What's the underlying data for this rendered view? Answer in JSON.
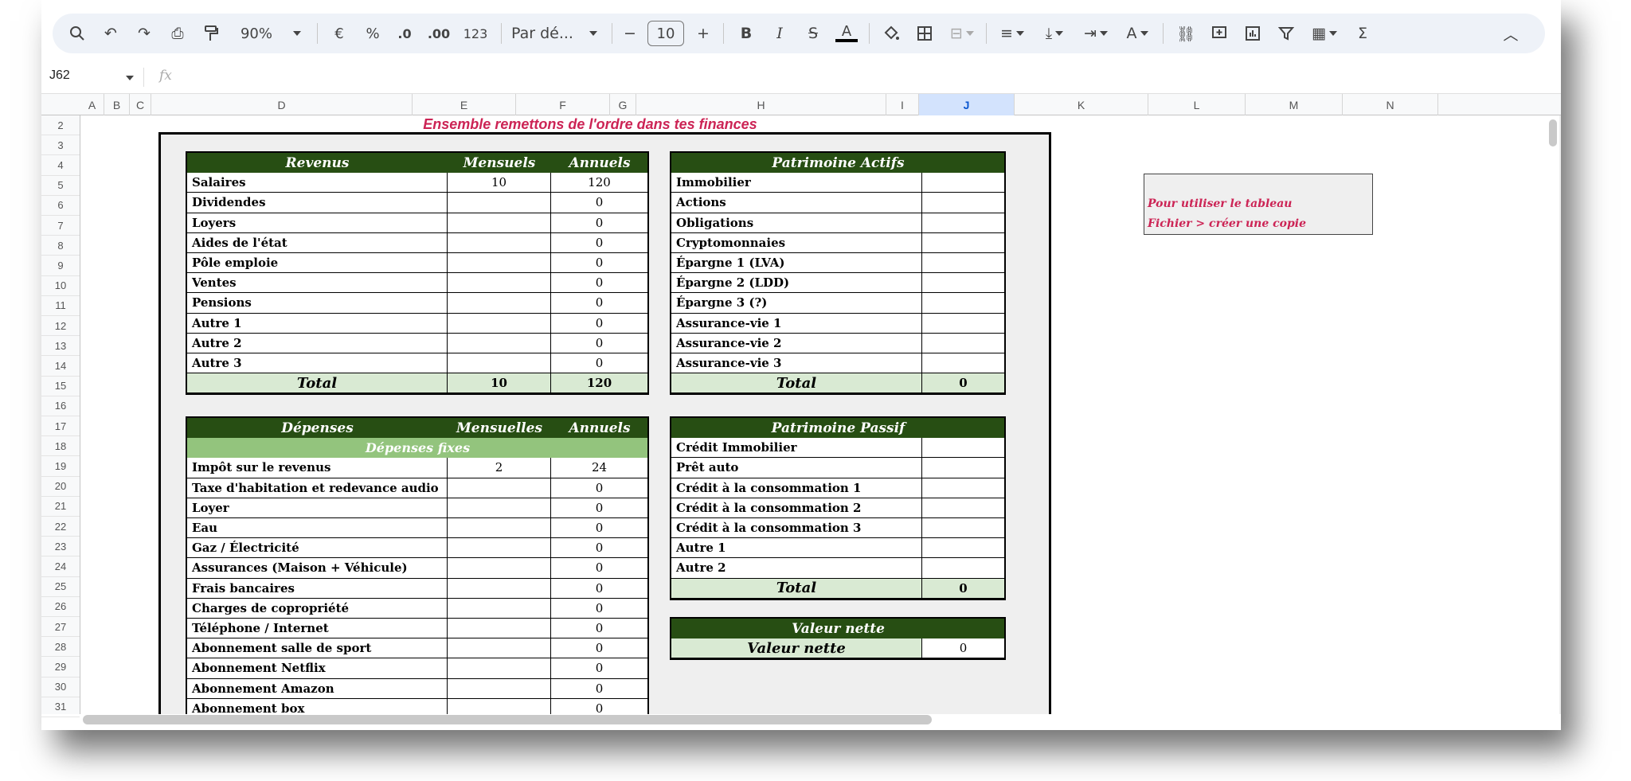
{
  "toolbar": {
    "zoom": "90%",
    "format_currency": "€",
    "format_percent": "%",
    "decimal_less": ".0",
    "decimal_more": ".00",
    "format_number": "123",
    "font": "Par dé...",
    "font_size": "10"
  },
  "formula_bar": {
    "cell_ref": "J62",
    "fx": "fx",
    "value": ""
  },
  "columns": [
    "A",
    "B",
    "C",
    "D",
    "E",
    "F",
    "G",
    "H",
    "I",
    "J",
    "K",
    "L",
    "M",
    "N"
  ],
  "rows": [
    "2",
    "3",
    "4",
    "5",
    "6",
    "7",
    "8",
    "9",
    "10",
    "11",
    "12",
    "13",
    "14",
    "15",
    "16",
    "17",
    "18",
    "19",
    "20",
    "21",
    "22",
    "23",
    "24",
    "25",
    "26",
    "27",
    "28",
    "29",
    "30",
    "31"
  ],
  "sheet": {
    "title": "Ensemble remettons de l'ordre dans tes finances",
    "revenus": {
      "header": [
        "Revenus",
        "Mensuels",
        "Annuels"
      ],
      "rows": [
        [
          "Salaires",
          "10",
          "120"
        ],
        [
          "Dividendes",
          "",
          "0"
        ],
        [
          "Loyers",
          "",
          "0"
        ],
        [
          "Aides de l'état",
          "",
          "0"
        ],
        [
          "Pôle emploie",
          "",
          "0"
        ],
        [
          "Ventes",
          "",
          "0"
        ],
        [
          "Pensions",
          "",
          "0"
        ],
        [
          "Autre 1",
          "",
          "0"
        ],
        [
          "Autre 2",
          "",
          "0"
        ],
        [
          "Autre 3",
          "",
          "0"
        ]
      ],
      "total": [
        "Total",
        "10",
        "120"
      ]
    },
    "actifs": {
      "header": "Patrimoine Actifs",
      "rows": [
        [
          "Immobilier",
          ""
        ],
        [
          "Actions",
          ""
        ],
        [
          "Obligations",
          ""
        ],
        [
          "Cryptomonnaies",
          ""
        ],
        [
          "Épargne 1 (LVA)",
          ""
        ],
        [
          "Épargne 2 (LDD)",
          ""
        ],
        [
          "Épargne 3 (?)",
          ""
        ],
        [
          "Assurance-vie 1",
          ""
        ],
        [
          "Assurance-vie 2",
          ""
        ],
        [
          "Assurance-vie 3",
          ""
        ]
      ],
      "total": [
        "Total",
        "0"
      ]
    },
    "depenses": {
      "header": [
        "Dépenses",
        "Mensuelles",
        "Annuels"
      ],
      "subheader": "Dépenses fixes",
      "rows": [
        [
          "Impôt sur le revenus",
          "2",
          "24"
        ],
        [
          "Taxe d'habitation et redevance audio",
          "",
          "0"
        ],
        [
          "Loyer",
          "",
          "0"
        ],
        [
          "Eau",
          "",
          "0"
        ],
        [
          "Gaz / Électricité",
          "",
          "0"
        ],
        [
          "Assurances (Maison + Véhicule)",
          "",
          "0"
        ],
        [
          "Frais bancaires",
          "",
          "0"
        ],
        [
          "Charges de copropriété",
          "",
          "0"
        ],
        [
          "Téléphone / Internet",
          "",
          "0"
        ],
        [
          "Abonnement salle de sport",
          "",
          "0"
        ],
        [
          "Abonnement Netflix",
          "",
          "0"
        ],
        [
          "Abonnement Amazon",
          "",
          "0"
        ],
        [
          "Abonnement box",
          "",
          "0"
        ]
      ]
    },
    "passif": {
      "header": "Patrimoine Passif",
      "rows": [
        [
          "Crédit Immobilier",
          ""
        ],
        [
          "Prêt auto",
          ""
        ],
        [
          "Crédit à la consommation 1",
          ""
        ],
        [
          "Crédit à la consommation 2",
          ""
        ],
        [
          "Crédit à la consommation 3",
          ""
        ],
        [
          "Autre 1",
          ""
        ],
        [
          "Autre 2",
          ""
        ]
      ],
      "total": [
        "Total",
        "0"
      ]
    },
    "valeur": {
      "header": "Valeur nette",
      "label": "Valeur nette",
      "value": "0"
    },
    "note": {
      "line1": "Pour utiliser le tableau",
      "line2": "Fichier > créer une copie"
    }
  },
  "colors": {
    "dark_green": "#274e13",
    "light_green": "#93c47d",
    "total_green": "#d9ead3",
    "title_red": "#cc2455"
  }
}
